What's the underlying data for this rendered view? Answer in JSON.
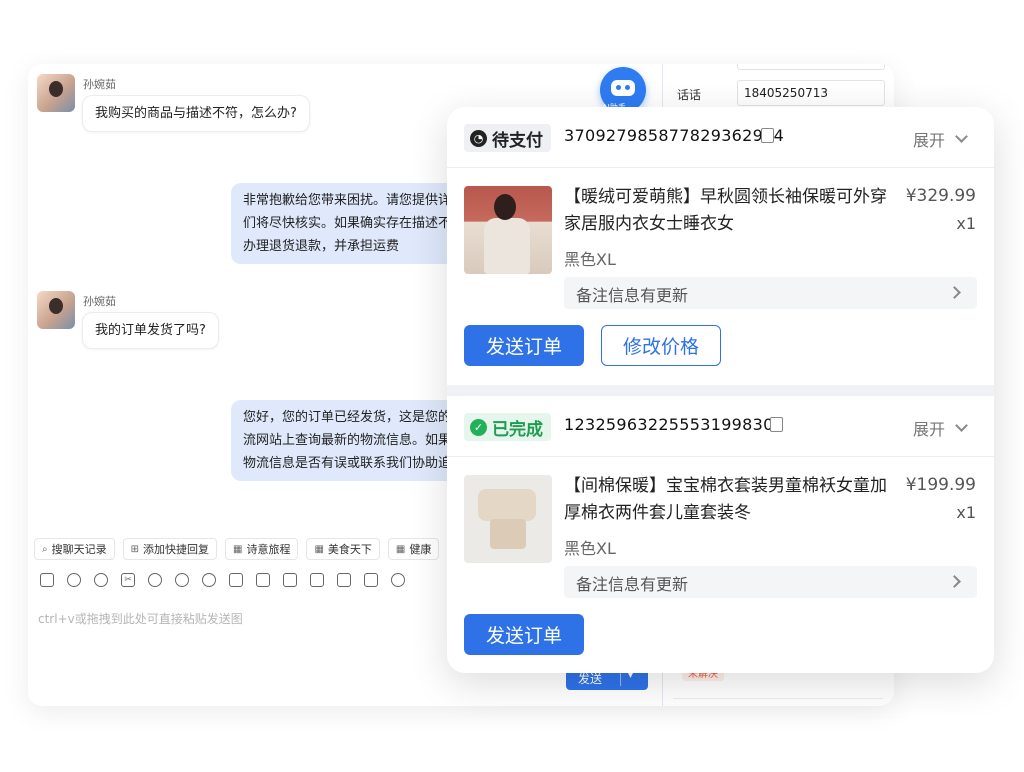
{
  "chat": {
    "messages": [
      {
        "sender": "孙婉茹",
        "text": "我购买的商品与描述不符，怎么办?"
      },
      {
        "lines": [
          "非常抱歉给您带来困扰。请您提供详",
          "们将尽快核实。如果确实存在描述不",
          "办理退货退款，并承担运费"
        ]
      },
      {
        "sender": "孙婉茹",
        "text": "我的订单发货了吗?"
      },
      {
        "lines": [
          "您好，您的订单已经发货，这是您的",
          "流网站上查询最新的物流信息。如果",
          "物流信息是否有误或联系我们协助追"
        ]
      }
    ],
    "quick_replies": [
      "搜聊天记录",
      "添加快捷回复",
      "诗意旅程",
      "美食天下",
      "健康"
    ],
    "input_placeholder": "ctrl+v或拖拽到此处可直接粘贴发送图",
    "send_label": "发送",
    "ai_label": "AI助手"
  },
  "side_panel": {
    "phone_label": "话话",
    "phone_value": "18405250713",
    "status_tag": "未解决"
  },
  "orders": [
    {
      "status": "待支付",
      "status_icon": "clock-icon",
      "order_no": "370927985877829362944",
      "expand_label": "展开",
      "title": "【暖绒可爱萌熊】早秋圆领长袖保暖可外穿家居服内衣女士睡衣女",
      "price": "¥329.99",
      "qty": "x1",
      "variant": "黑色XL",
      "remark": "备注信息有更新",
      "buttons": [
        "发送订单",
        "修改价格"
      ]
    },
    {
      "status": "已完成",
      "status_icon": "check-circle-icon",
      "order_no": "123259632255531998302",
      "expand_label": "展开",
      "title": "【间棉保暖】宝宝棉衣套装男童棉袄女童加厚棉衣两件套儿童套装冬",
      "price": "¥199.99",
      "qty": "x1",
      "variant": "黑色XL",
      "remark": "备注信息有更新",
      "buttons": [
        "发送订单"
      ]
    }
  ],
  "colors": {
    "primary": "#2f72e8",
    "done_green": "#22b15a",
    "chat_out_bubble": "#dfe9fb"
  }
}
